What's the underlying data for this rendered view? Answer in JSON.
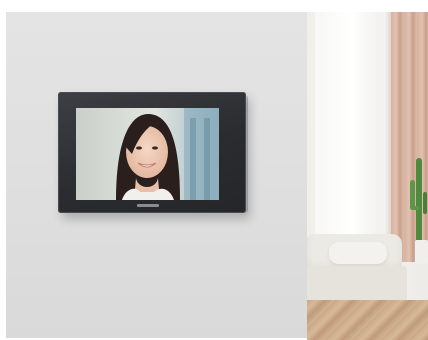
{
  "scene": {
    "description_free": true,
    "colors": {
      "wall": "#dedede",
      "device_body": "#2b2c30",
      "device_edge": "#c8cbd1",
      "curtain": "#d6b29f",
      "floor": "#c9a888"
    },
    "icons": [
      "video-intercom-monitor",
      "face-photo",
      "room-photo"
    ]
  }
}
